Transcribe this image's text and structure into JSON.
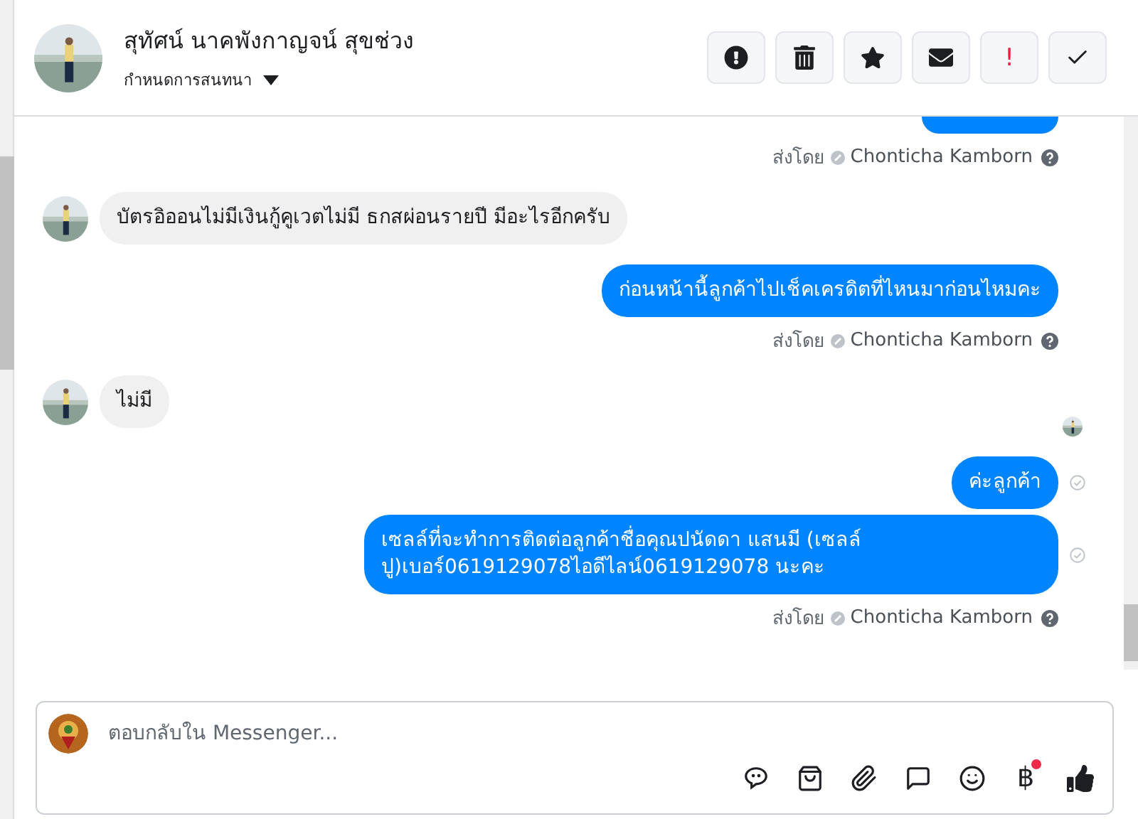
{
  "header": {
    "name": "สุทัศน์ นาคพังกาญจน์ สุขช่วง",
    "subtitle": "กำหนดการสนทนา",
    "actions": [
      {
        "kind": "alert"
      },
      {
        "kind": "trash"
      },
      {
        "kind": "star"
      },
      {
        "kind": "mail"
      },
      {
        "kind": "important",
        "label": "!"
      },
      {
        "kind": "check"
      }
    ]
  },
  "messages": [
    {
      "kind": "outgoing_cut"
    },
    {
      "kind": "sent_by",
      "label": "ส่งโดย",
      "name": "Chonticha Kamborn"
    },
    {
      "kind": "incoming",
      "text": "บัตรอิออนไม่มีเงินกู้คูเวตไม่มี ธกสผ่อนรายปี มีอะไรอีกครับ"
    },
    {
      "kind": "outgoing",
      "text": "ก่อนหน้านี้ลูกค้าไปเช็คเครดิตที่ไหนมาก่อนไหมคะ",
      "delivered": false
    },
    {
      "kind": "sent_by",
      "label": "ส่งโดย",
      "name": "Chonticha Kamborn"
    },
    {
      "kind": "incoming",
      "text": "ไม่มี"
    },
    {
      "kind": "seen"
    },
    {
      "kind": "outgoing",
      "text": "ค่ะลูกค้า",
      "delivered": true
    },
    {
      "kind": "outgoing",
      "text": "เซลล์ที่จะทำการติดต่อลูกค้าชื่อคุณปนัดดา แสนมี (เซลล์ปู)เบอร์0619129078ไอดีไลน์0619129078 นะคะ",
      "delivered": true
    },
    {
      "kind": "sent_by",
      "label": "ส่งโดย",
      "name": "Chonticha Kamborn"
    }
  ],
  "composer": {
    "placeholder": "ตอบกลับใน Messenger...",
    "tools": [
      {
        "kind": "saved"
      },
      {
        "kind": "shop"
      },
      {
        "kind": "attach"
      },
      {
        "kind": "chat"
      },
      {
        "kind": "emoji"
      },
      {
        "kind": "baht",
        "label": "฿",
        "badge": true
      },
      {
        "kind": "like"
      }
    ]
  }
}
